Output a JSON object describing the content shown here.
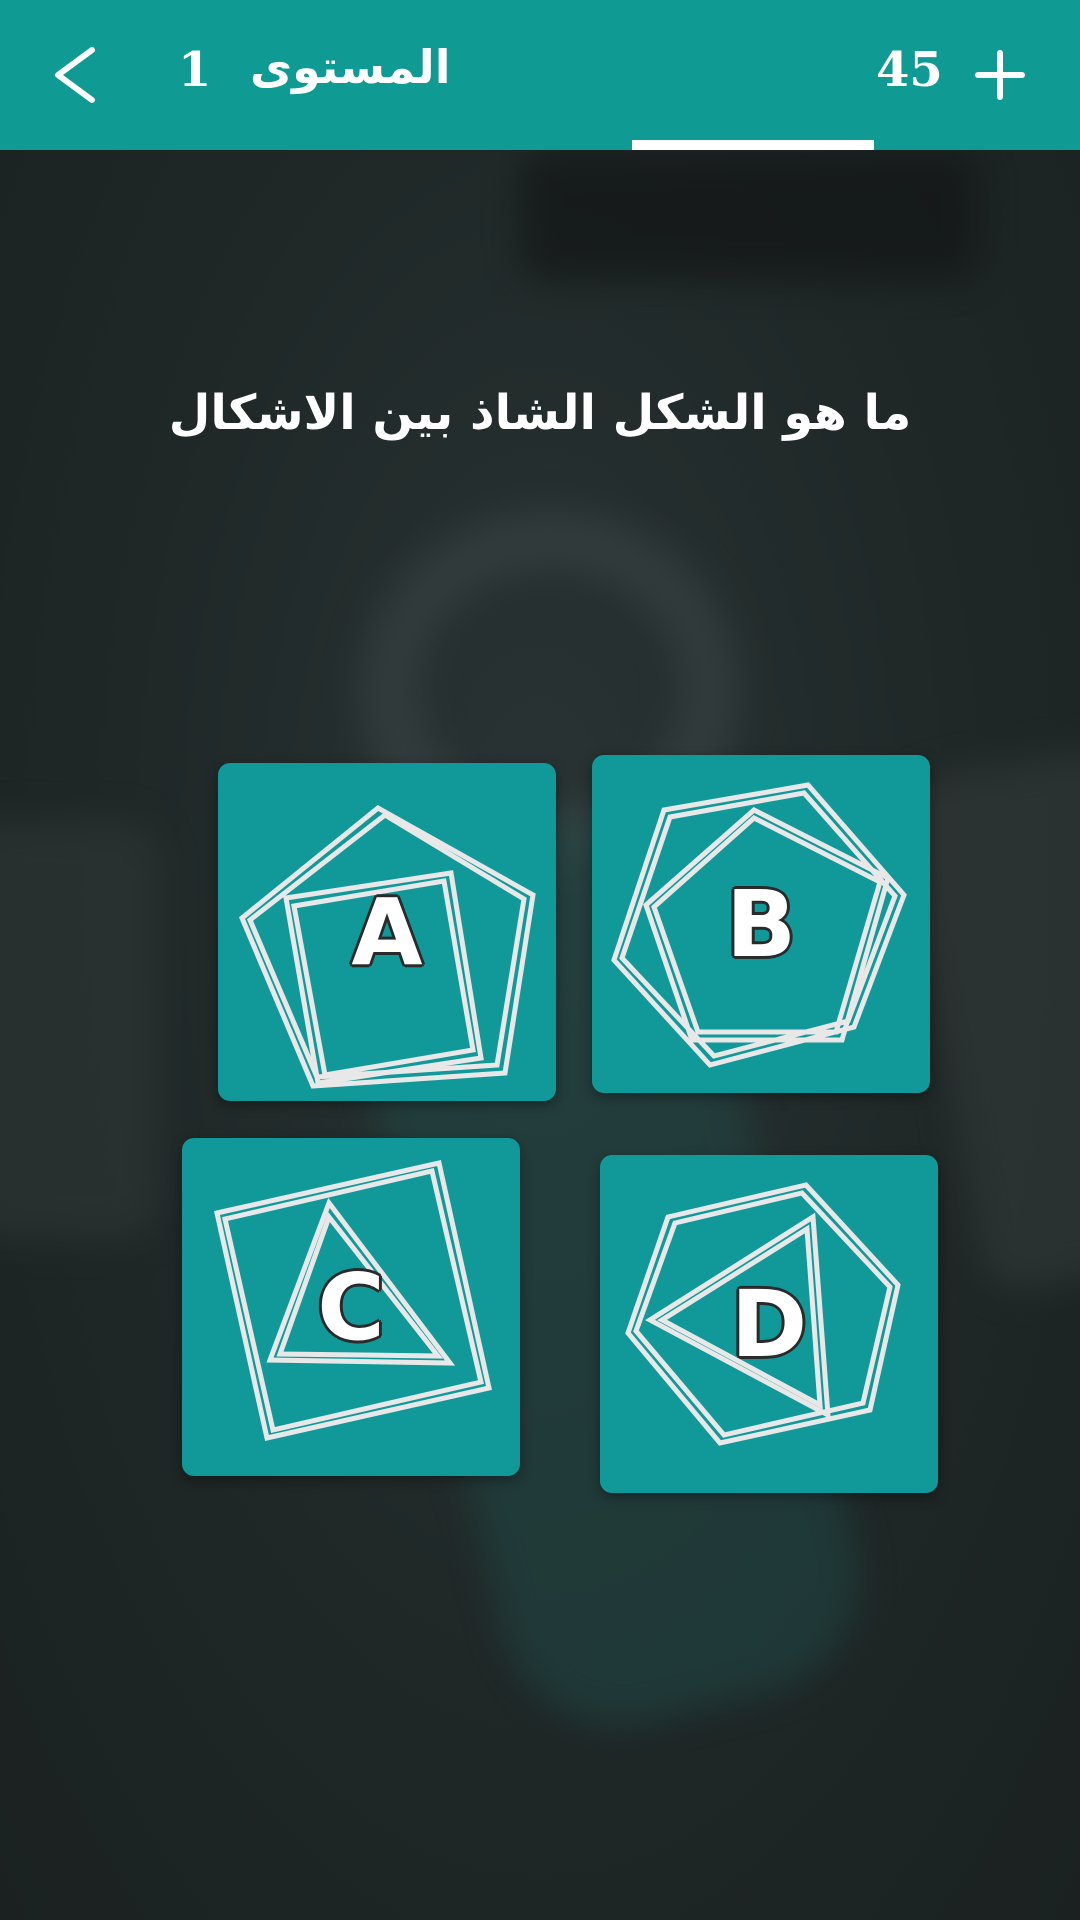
{
  "header": {
    "back_icon": "chevron-left-icon",
    "level_label": "المستوى",
    "level_number": "1",
    "coins": "45",
    "add_icon": "plus-icon",
    "bg_color": "#0f9a94"
  },
  "question": "ما هو الشكل الشاذ بين الاشكال",
  "options": [
    {
      "letter": "A",
      "outer_shape": "pentagon",
      "inner_shape": "square"
    },
    {
      "letter": "B",
      "outer_shape": "hexagon",
      "inner_shape": "pentagon"
    },
    {
      "letter": "C",
      "outer_shape": "square",
      "inner_shape": "triangle"
    },
    {
      "letter": "D",
      "outer_shape": "hexagon",
      "inner_shape": "triangle"
    }
  ],
  "colors": {
    "tile": "#11999a",
    "background": "#1f2626",
    "outline": "#e8e8e8"
  }
}
